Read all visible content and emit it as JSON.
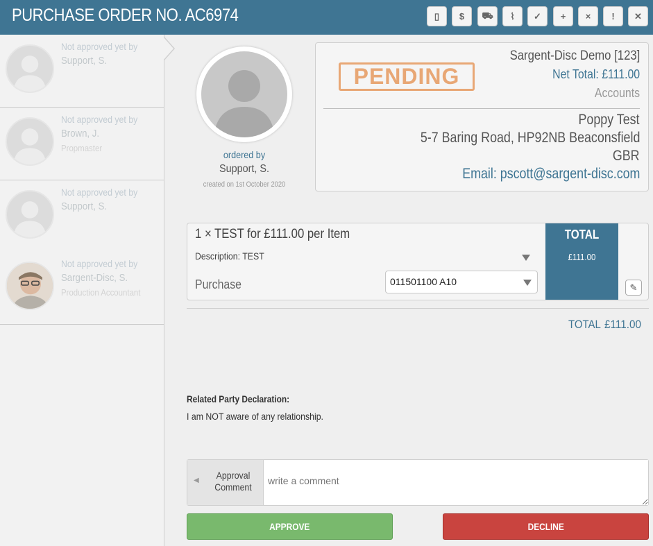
{
  "header": {
    "title": "PURCHASE ORDER NO. AC6974",
    "toolbar": [
      {
        "icon": "document-icon",
        "glyph": "▯"
      },
      {
        "icon": "dollar-icon",
        "glyph": "$"
      },
      {
        "icon": "truck-icon",
        "glyph": "⛟"
      },
      {
        "icon": "paperclip-icon",
        "glyph": "⌇"
      },
      {
        "icon": "check-circle-icon",
        "glyph": "✓"
      },
      {
        "icon": "plus-circle-icon",
        "glyph": "+"
      },
      {
        "icon": "x-circle-icon",
        "glyph": "×"
      },
      {
        "icon": "exclamation-icon",
        "glyph": "!"
      },
      {
        "icon": "close-icon",
        "glyph": "✕"
      }
    ]
  },
  "approvers": [
    {
      "status": "Not approved yet by",
      "name": "Support, S.",
      "role": ""
    },
    {
      "status": "Not approved yet by",
      "name": "Brown, J.",
      "role": "Propmaster"
    },
    {
      "status": "Not approved yet by",
      "name": "Support, S.",
      "role": ""
    },
    {
      "status": "Not approved yet by",
      "name": "Sargent-Disc, S.",
      "role": "Production Accountant"
    }
  ],
  "order": {
    "ordered_by_label": "ordered by",
    "ordered_by": "Support, S.",
    "created": "created on 1st October 2020"
  },
  "summary": {
    "stamp": "PENDING",
    "company": "Sargent-Disc Demo [123]",
    "net_total": "Net Total: £111.00",
    "department": "Accounts",
    "contact_name": "Poppy Test",
    "address": "5-7 Baring Road, HP92NB Beaconsfield",
    "country": "GBR",
    "email": "Email: pscott@sargent-disc.com"
  },
  "item": {
    "title": "1 × TEST for £111.00 per Item",
    "description": "Description: TEST",
    "type_label": "Purchase",
    "code": "011501100   A10",
    "total_header": "TOTAL",
    "total_value": "£111.00"
  },
  "totals": {
    "label": "TOTAL",
    "value": "£111.00"
  },
  "declaration": {
    "heading": "Related Party Declaration:",
    "text": "I am NOT aware of any relationship."
  },
  "comment": {
    "label": "Approval Comment",
    "placeholder": "write a comment"
  },
  "actions": {
    "approve": "APPROVE",
    "decline": "DECLINE"
  },
  "colors": {
    "header": "#3f7593",
    "approve": "#79b96d",
    "decline": "#c9443f",
    "stamp": "#e69a5f"
  }
}
